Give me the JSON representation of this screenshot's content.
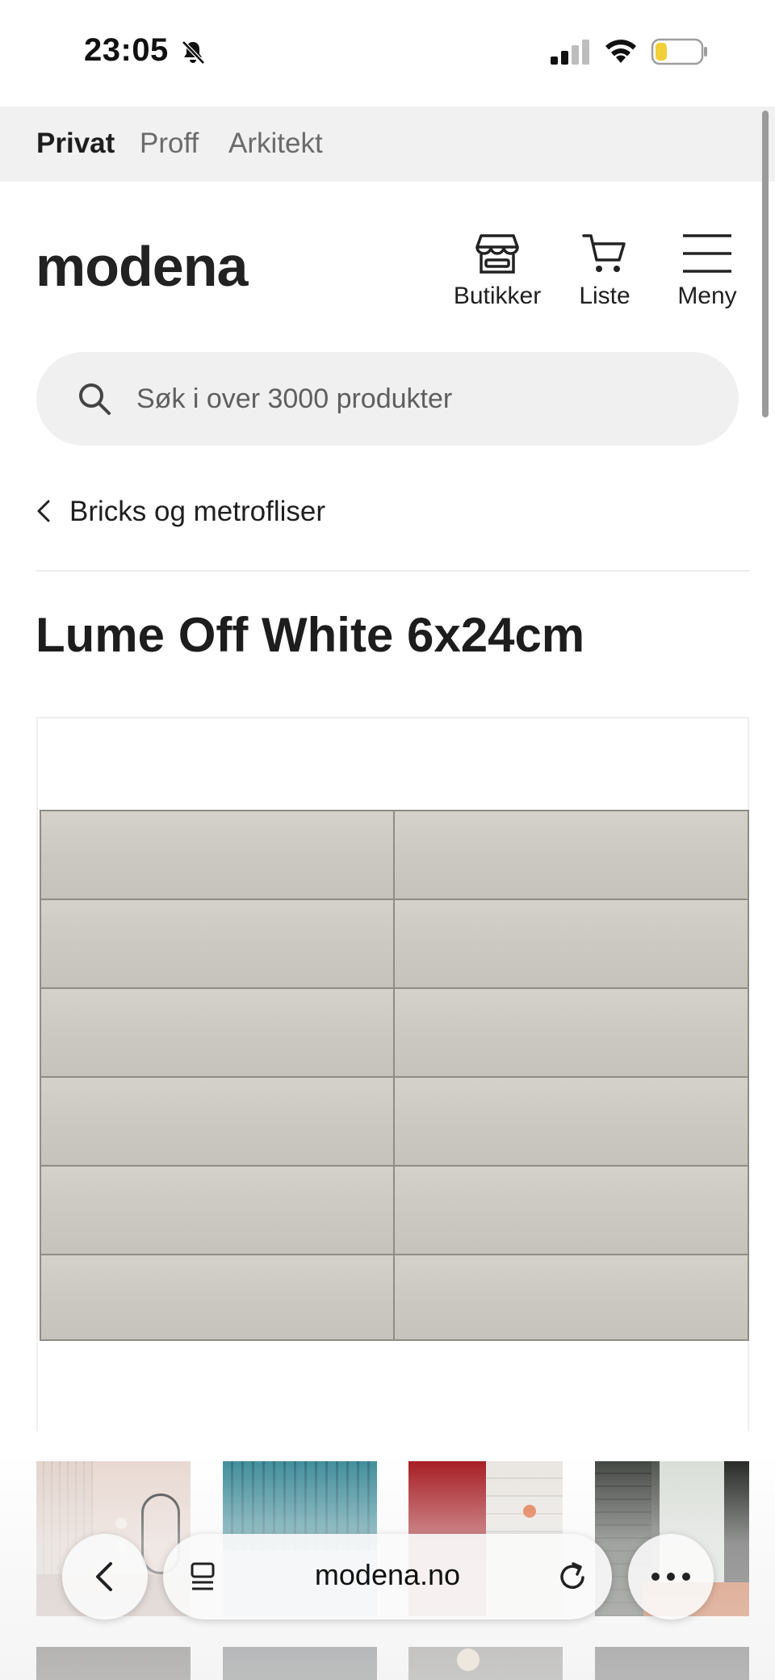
{
  "status_bar": {
    "time": "23:05"
  },
  "audience_tabs": [
    {
      "label": "Privat",
      "active": true
    },
    {
      "label": "Proff",
      "active": false
    },
    {
      "label": "Arkitekt",
      "active": false
    }
  ],
  "header": {
    "logo_text": "modena",
    "stores_label": "Butikker",
    "list_label": "Liste",
    "menu_label": "Meny"
  },
  "search": {
    "placeholder": "Søk i over 3000 produkter",
    "value": ""
  },
  "breadcrumb": {
    "label": "Bricks og metrofliser"
  },
  "product": {
    "title": "Lume Off White 6x24cm"
  },
  "browser": {
    "url": "modena.no"
  },
  "colors": {
    "accent_text": "#1e1e1e",
    "tile": "#cbc8c2",
    "battery_low": "#f2d03a"
  }
}
